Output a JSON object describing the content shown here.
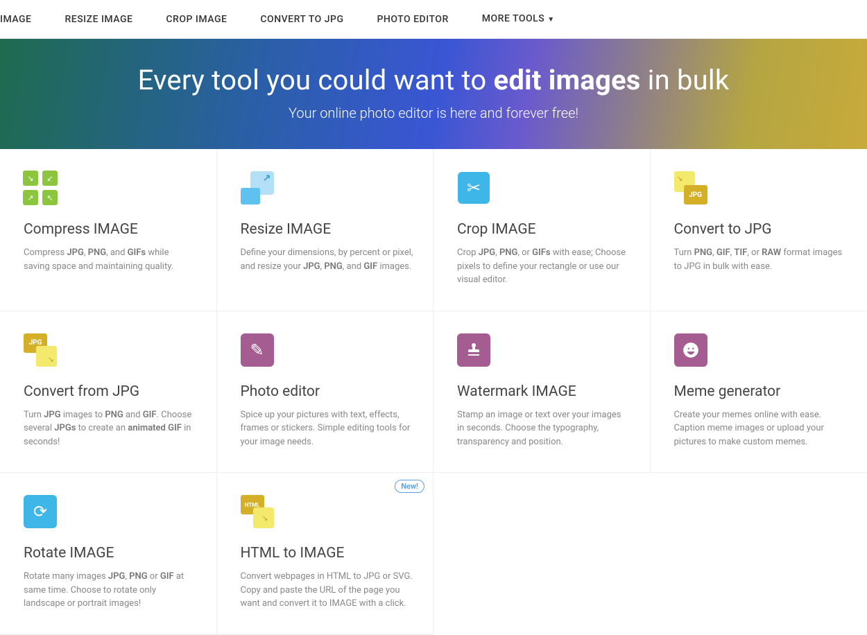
{
  "nav": {
    "item0": "IMAGE",
    "item1": "RESIZE IMAGE",
    "item2": "CROP IMAGE",
    "item3": "CONVERT TO JPG",
    "item4": "PHOTO EDITOR",
    "item5": "MORE TOOLS"
  },
  "hero": {
    "title_pre": "Every tool you could want to ",
    "title_bold": "edit images",
    "title_post": " in bulk",
    "subtitle": "Your online photo editor is here and forever free!"
  },
  "badge_new": "New!",
  "tools": {
    "compress": {
      "title": "Compress IMAGE"
    },
    "resize": {
      "title": "Resize IMAGE"
    },
    "crop": {
      "title": "Crop IMAGE"
    },
    "tojpg": {
      "title": "Convert to JPG",
      "jpg_label": "JPG"
    },
    "fromjpg": {
      "title": "Convert from JPG",
      "jpg_label": "JPG"
    },
    "photo": {
      "title": "Photo editor"
    },
    "watermark": {
      "title": "Watermark IMAGE"
    },
    "meme": {
      "title": "Meme generator"
    },
    "rotate": {
      "title": "Rotate IMAGE"
    },
    "html": {
      "title": "HTML to IMAGE",
      "html_label": "HTML"
    }
  },
  "desc": {
    "compress": {
      "t0": "Compress ",
      "b0": "JPG",
      "t1": ", ",
      "b1": "PNG",
      "t2": ", and ",
      "b2": "GIFs",
      "t3": " while saving space and maintaining quality."
    },
    "resize": {
      "t0": "Define your dimensions, by percent or pixel, and resize your ",
      "b0": "JPG",
      "t1": ", ",
      "b1": "PNG",
      "t2": ", and ",
      "b2": "GIF",
      "t3": " images."
    },
    "crop": {
      "t0": "Crop ",
      "b0": "JPG",
      "t1": ", ",
      "b1": "PNG",
      "t2": ", or ",
      "b2": "GIFs",
      "t3": " with ease; Choose pixels to define your rectangle or use our visual editor."
    },
    "tojpg": {
      "t0": "Turn ",
      "b0": "PNG",
      "t1": ", ",
      "b1": "GIF",
      "t2": ", ",
      "b2": "TIF",
      "t3": ", or ",
      "b3": "RAW",
      "t4": " format images to JPG in bulk with ease."
    },
    "fromjpg": {
      "t0": "Turn ",
      "b0": "JPG",
      "t1": " images to ",
      "b1": "PNG",
      "t2": " and ",
      "b2": "GIF",
      "t3": ". Choose several ",
      "b3": "JPGs",
      "t4": " to create an ",
      "b4": "animated GIF",
      "t5": " in seconds!"
    },
    "photo": {
      "t0": "Spice up your pictures with text, effects, frames or stickers. Simple editing tools for your image needs."
    },
    "watermark": {
      "t0": "Stamp an image or text over your images in seconds. Choose the typography, transparency and position."
    },
    "meme": {
      "t0": "Create your memes online with ease. Caption meme images or upload your pictures to make custom memes."
    },
    "rotate": {
      "t0": "Rotate many images ",
      "b0": "JPG",
      "t1": ", ",
      "b1": "PNG",
      "t2": " or ",
      "b2": "GIF",
      "t3": " at same time. Choose to rotate only landscape or portrait images!"
    },
    "html": {
      "t0": "Convert webpages in HTML to JPG or SVG. Copy and paste the URL of the page you want and convert it to IMAGE with a click."
    }
  }
}
